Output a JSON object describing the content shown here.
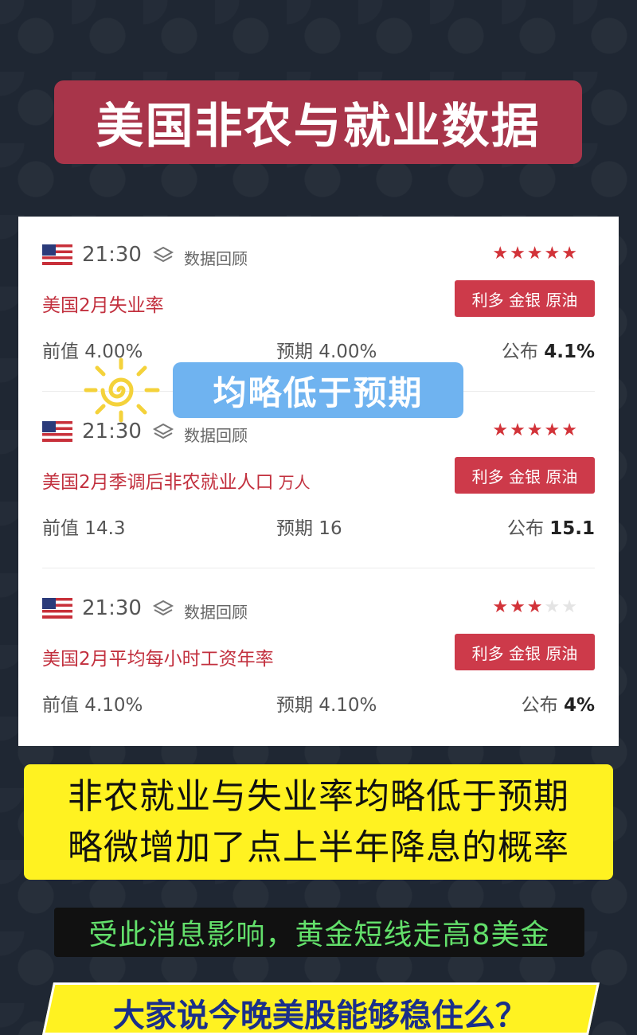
{
  "header": {
    "title": "美国非农与就业数据"
  },
  "events": [
    {
      "time": "21:30",
      "review_label": "数据回顾",
      "title": "美国2月失业率",
      "unit": "",
      "tags": "利多 金银 原油",
      "rating": 5,
      "previous": "前值 4.00%",
      "forecast": "预期 4.00%",
      "actual_label": "公布",
      "actual_value": "4.1%"
    },
    {
      "time": "21:30",
      "review_label": "数据回顾",
      "title": "美国2月季调后非农就业人口",
      "unit": "万人",
      "tags": "利多 金银 原油",
      "rating": 5,
      "previous": "前值 14.3",
      "forecast": "预期 16",
      "actual_label": "公布",
      "actual_value": "15.1"
    },
    {
      "time": "21:30",
      "review_label": "数据回顾",
      "title": "美国2月平均每小时工资年率",
      "unit": "",
      "tags": "利多 金银 原油",
      "rating": 3,
      "previous": "前值 4.10%",
      "forecast": "预期 4.10%",
      "actual_label": "公布",
      "actual_value": "4%"
    }
  ],
  "overlay": {
    "label": "均略低于预期"
  },
  "summary": {
    "line1": "非农就业与失业率均略低于预期",
    "line2": "略微增加了点上半年降息的概率"
  },
  "note": {
    "text": "受此消息影响，黄金短线走高8美金"
  },
  "bottom": {
    "text": "大家说今晚美股能够稳住么？"
  },
  "colors": {
    "banner": "#a8354a",
    "accent_red": "#c2303e",
    "tag_bg": "#cd3a4a",
    "overlay_blue": "#6fb3f0",
    "highlight_yellow": "#fff221",
    "note_green": "#63e06b"
  },
  "icons": {
    "flag": "us-flag-icon",
    "layers": "layers-icon",
    "star": "star-icon",
    "sun": "sun-icon"
  }
}
